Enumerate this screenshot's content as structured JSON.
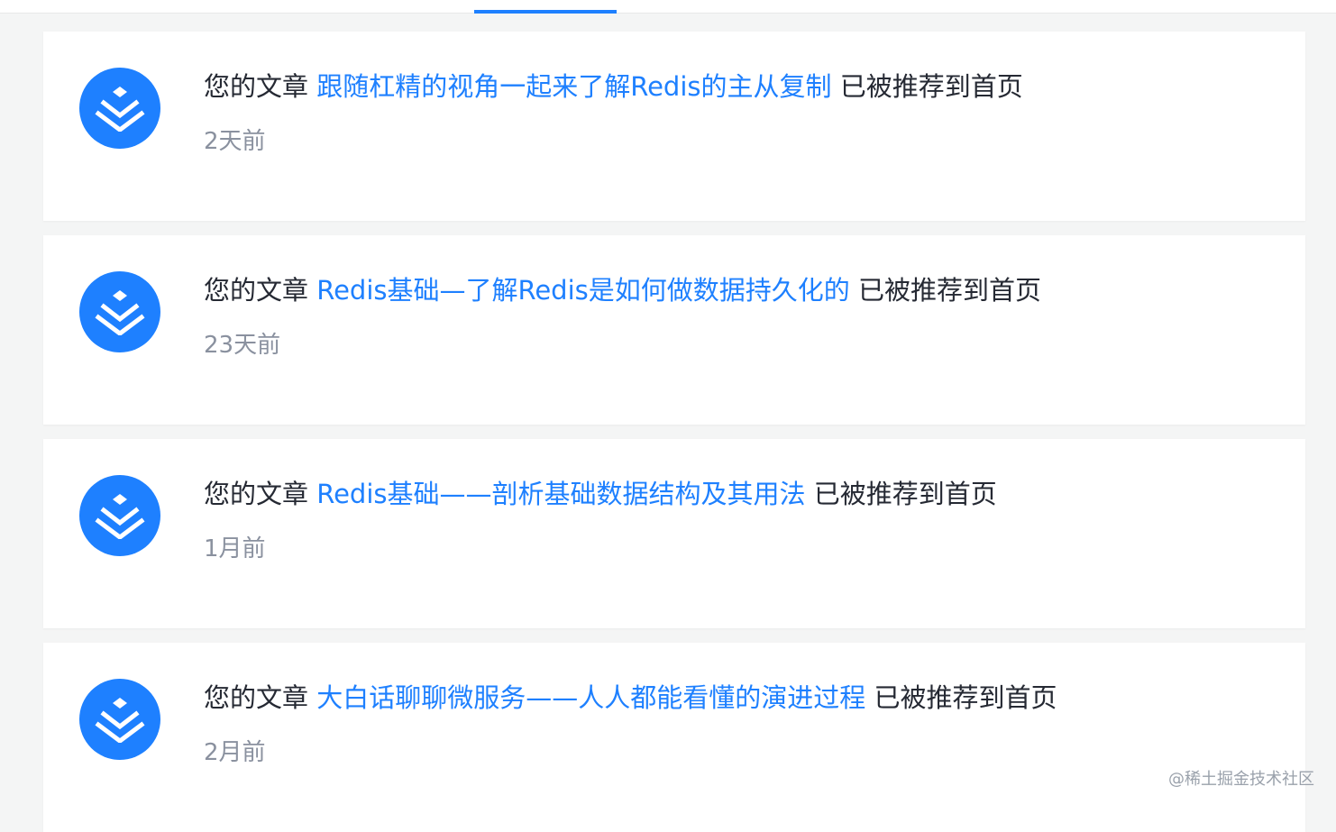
{
  "notifications": [
    {
      "prefix": "您的文章",
      "title": "跟随杠精的视角一起来了解Redis的主从复制",
      "suffix": "已被推荐到首页",
      "time": "2天前"
    },
    {
      "prefix": "您的文章",
      "title": "Redis基础—了解Redis是如何做数据持久化的",
      "suffix": "已被推荐到首页",
      "time": "23天前"
    },
    {
      "prefix": "您的文章",
      "title": "Redis基础——剖析基础数据结构及其用法",
      "suffix": "已被推荐到首页",
      "time": "1月前"
    },
    {
      "prefix": "您的文章",
      "title": "大白话聊聊微服务——人人都能看懂的演进过程",
      "suffix": "已被推荐到首页",
      "time": "2月前"
    }
  ],
  "watermark": "@稀土掘金技术社区",
  "colors": {
    "accent": "#1e80ff",
    "text": "#252933",
    "muted": "#8a919f",
    "background": "#f4f5f5"
  },
  "icons": {
    "avatar": "juejin-logo-icon"
  }
}
